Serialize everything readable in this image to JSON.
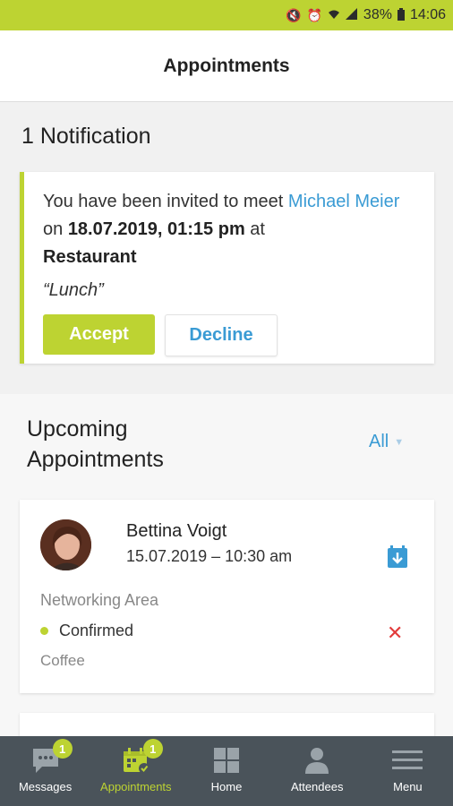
{
  "status_bar": {
    "battery": "38%",
    "time": "14:06",
    "icons": [
      "mute-icon",
      "alarm-icon",
      "wifi-icon",
      "signal-icon",
      "battery-icon"
    ]
  },
  "header": {
    "title": "Appointments"
  },
  "notifications": {
    "heading": "1 Notification",
    "card": {
      "text_prefix": "You have been invited to meet ",
      "person": "Michael Meier",
      "text_on": " on ",
      "datetime": "18.07.2019, 01:15 pm",
      "text_at": " at",
      "place": "Restaurant",
      "note": "“Lunch”",
      "accept_label": "Accept",
      "decline_label": "Decline"
    }
  },
  "upcoming": {
    "title": "Upcoming Appointments",
    "filter_label": "All",
    "appointments": [
      {
        "name": "Bettina Voigt",
        "datetime": "15.07.2019 – 10:30 am",
        "location": "Networking Area",
        "status": "Confirmed",
        "note": "Coffee"
      }
    ]
  },
  "bottom_nav": {
    "items": [
      {
        "label": "Messages",
        "badge": "1",
        "icon": "chat-bubble-icon"
      },
      {
        "label": "Appointments",
        "badge": "1",
        "icon": "calendar-check-icon",
        "active": true
      },
      {
        "label": "Home",
        "icon": "grid-icon"
      },
      {
        "label": "Attendees",
        "icon": "person-icon"
      },
      {
        "label": "Menu",
        "icon": "hamburger-icon"
      }
    ]
  },
  "colors": {
    "accent": "#bdd332",
    "link": "#3a9bd4",
    "danger": "#e23b3b",
    "nav_bg": "#4a535a"
  }
}
